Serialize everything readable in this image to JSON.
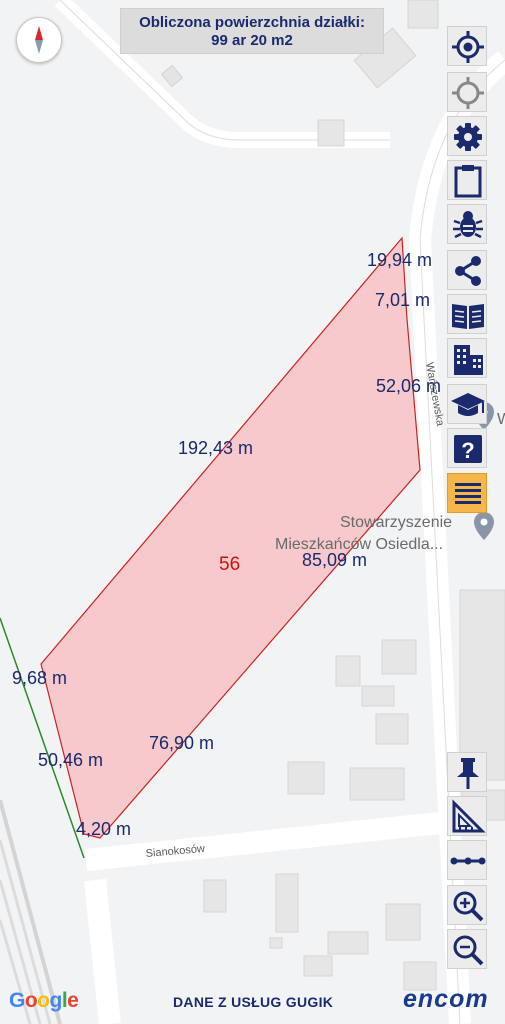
{
  "banner": {
    "line1": "Obliczona powierzchnia działki:",
    "line2": "99 ar 20 m2"
  },
  "parcel": {
    "number": "56",
    "fill_color": "#f7c9cc",
    "edge_color": "#cc2222",
    "measurements": [
      "19,94 m",
      "7,01 m",
      "52,06 m",
      "192,43 m",
      "85,09 m",
      "9,68 m",
      "76,90 m",
      "50,46 m",
      "4,20 m"
    ]
  },
  "streets": {
    "east": "Wańszewska",
    "south": "Sianokosów"
  },
  "poi": {
    "line1": "Stowarzyszenie",
    "line2": "Mieszkańców Osiedla..."
  },
  "edge_letter": "W",
  "toolbar_top": [
    {
      "icon": "locate-crosshair-icon"
    },
    {
      "icon": "gps-target-icon"
    },
    {
      "icon": "gear-icon"
    },
    {
      "icon": "clipboard-icon"
    },
    {
      "icon": "bug-icon"
    },
    {
      "icon": "share-icon"
    },
    {
      "icon": "book-icon"
    },
    {
      "icon": "building-icon"
    },
    {
      "icon": "graduation-cap-icon"
    },
    {
      "icon": "help-icon",
      "text": "?"
    },
    {
      "icon": "menu-icon",
      "active": true
    }
  ],
  "toolbar_bottom": [
    {
      "icon": "pin-icon"
    },
    {
      "icon": "set-square-icon"
    },
    {
      "icon": "distance-icon"
    },
    {
      "icon": "zoom-in-icon"
    },
    {
      "icon": "zoom-out-icon"
    }
  ],
  "footer": {
    "google": "Google",
    "data_source": "DANE Z USŁUG GUGIK",
    "brand": "encom"
  },
  "colors": {
    "navy": "#1a2a6c",
    "parcel_text": "#1a2a6c",
    "parcel_number": "#cc1111",
    "active_tool": "#f5b74a",
    "railway_line": "#2a8a2a"
  }
}
